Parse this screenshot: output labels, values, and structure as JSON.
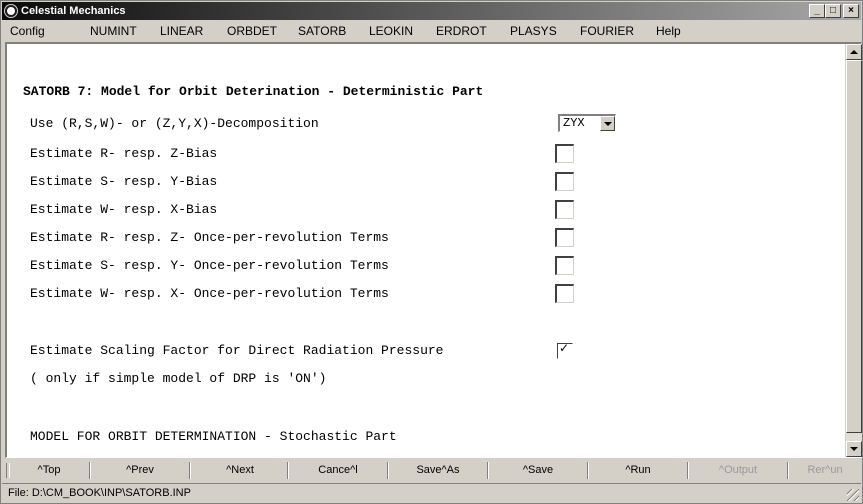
{
  "window": {
    "title": "Celestial Mechanics"
  },
  "menu": [
    "Config",
    "NUMINT",
    "LINEAR",
    "ORBDET",
    "SATORB",
    "LEOKIN",
    "ERDROT",
    "PLASYS",
    "FOURIER",
    "Help"
  ],
  "form": {
    "heading": "SATORB 7: Model for Orbit Deterination - Deterministic Part",
    "decomposition_label": "Use (R,S,W)- or (Z,Y,X)-Decomposition",
    "decomposition_value": "ZYX",
    "options": [
      {
        "label": "Estimate R- resp. Z-Bias",
        "checked": false
      },
      {
        "label": "Estimate S- resp. Y-Bias",
        "checked": false
      },
      {
        "label": "Estimate W- resp. X-Bias",
        "checked": false
      },
      {
        "label": "Estimate R- resp. Z- Once-per-revolution Terms",
        "checked": false
      },
      {
        "label": "Estimate S- resp. Y- Once-per-revolution Terms",
        "checked": false
      },
      {
        "label": "Estimate W- resp. X- Once-per-revolution Terms",
        "checked": false
      }
    ],
    "drp_label": "Estimate Scaling Factor for Direct Radiation Pressure",
    "drp_checked": true,
    "drp_note": "( only if simple model of DRP is 'ON')",
    "stochastic_heading": "MODEL FOR ORBIT DETERMINATION - Stochastic Part"
  },
  "toolbar": {
    "top": "^Top",
    "prev": "^Prev",
    "next": "^Next",
    "cancel": "Cance^l",
    "saveas": "Save^As",
    "save": "^Save",
    "run": "^Run",
    "output": "^Output",
    "rerun": "Rer^un"
  },
  "status": {
    "file": "File: D:\\CM_BOOK\\INP\\SATORB.INP"
  },
  "icons": {
    "app": "globe-icon",
    "min": "minimize-icon",
    "max": "maximize-icon",
    "close": "close-icon",
    "check": "checkmark-icon"
  }
}
